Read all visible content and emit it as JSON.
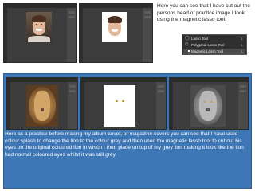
{
  "caption_top": "Here you can see that I have cut out the persons head of practice image I took using the magnetic lasso tool.",
  "caption_bottom": "Here as a practice before making my album cover, or magazine covers you can see that I have used colour splash to change the lion to the colour grey and then used the magnetic lasso tool to cut out his eyes on the original coloured lion in which I then place on top of my grey lion making it look like the lion had normal coloured eyes whilst it was still grey.",
  "lasso_menu": [
    {
      "label": "Lasso Tool",
      "shortcut": "L",
      "icon": "lasso-icon",
      "glyph": "◯",
      "active": false
    },
    {
      "label": "Polygonal Lasso Tool",
      "shortcut": "L",
      "icon": "polygonal-lasso-icon",
      "glyph": "⬠",
      "active": false
    },
    {
      "label": "Magnetic Lasso Tool",
      "shortcut": "L",
      "icon": "magnetic-lasso-icon",
      "glyph": "⌇",
      "active": true
    }
  ],
  "colors": {
    "app_bg": "#3c3c3c",
    "caption_panel": "#3e77b6",
    "lion_color": "#c79a5d",
    "lion_grey": "#a8a8a8"
  }
}
